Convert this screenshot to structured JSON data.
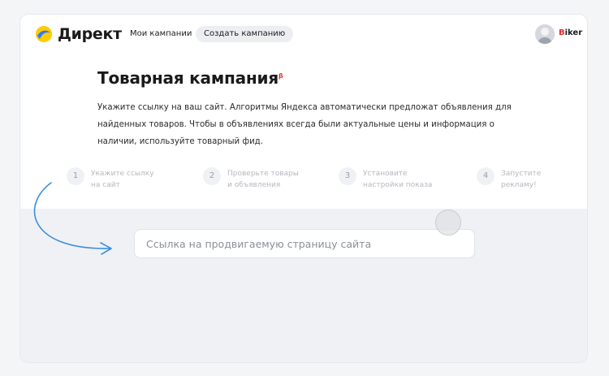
{
  "header": {
    "logo_text": "Директ",
    "nav": {
      "my_campaigns": "Мои кампании",
      "create_campaign": "Создать кампанию"
    },
    "user": {
      "name_first": "B",
      "name_rest": "iker"
    }
  },
  "main": {
    "title": "Товарная кампания",
    "beta_badge": "β",
    "description": "Укажите ссылку на ваш сайт. Алгоритмы Яндекса автоматически предложат объявления для найденных товаров. Чтобы в объявлениях всегда были актуальные цены и информация о наличии, используйте товарный фид.",
    "steps": [
      {
        "num": "1",
        "label": "Укажите ссылку на сайт"
      },
      {
        "num": "2",
        "label": "Проверьте товары и объявления"
      },
      {
        "num": "3",
        "label": "Установите настройки показа"
      },
      {
        "num": "4",
        "label": "Запустите рекламу!"
      }
    ],
    "url_input": {
      "value": "",
      "placeholder": "Ссылка на продвигаемую страницу сайта"
    }
  },
  "colors": {
    "accent_arrow": "#3b8ee0",
    "logo_yellow": "#ffcc00",
    "logo_blue": "#2f7bf5",
    "beta_red": "#e62e2e"
  }
}
